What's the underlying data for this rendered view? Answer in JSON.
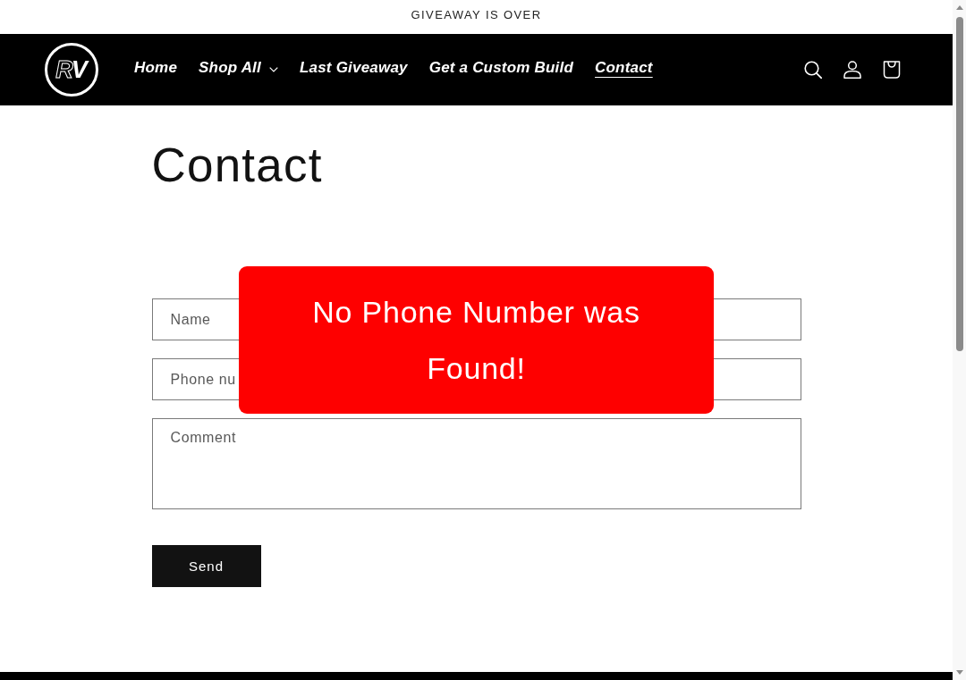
{
  "announcement": {
    "text": "GIVEAWAY IS OVER"
  },
  "header": {
    "logo": {
      "text": "RV"
    },
    "nav": [
      {
        "label": "Home",
        "selected": false,
        "dropdown": false
      },
      {
        "label": "Shop All",
        "selected": false,
        "dropdown": true
      },
      {
        "label": "Last Giveaway",
        "selected": false,
        "dropdown": false
      },
      {
        "label": "Get a Custom Build",
        "selected": false,
        "dropdown": false
      },
      {
        "label": "Contact",
        "selected": true,
        "dropdown": false
      }
    ]
  },
  "page": {
    "title": "Contact"
  },
  "form": {
    "fields": [
      {
        "kind": "input",
        "placeholder": "Name"
      },
      {
        "kind": "input",
        "placeholder": "Phone nu"
      },
      {
        "kind": "textarea",
        "placeholder": "Comment"
      }
    ],
    "submit": {
      "label": "Send"
    }
  },
  "alert": {
    "message": "No Phone Number was Found!"
  }
}
